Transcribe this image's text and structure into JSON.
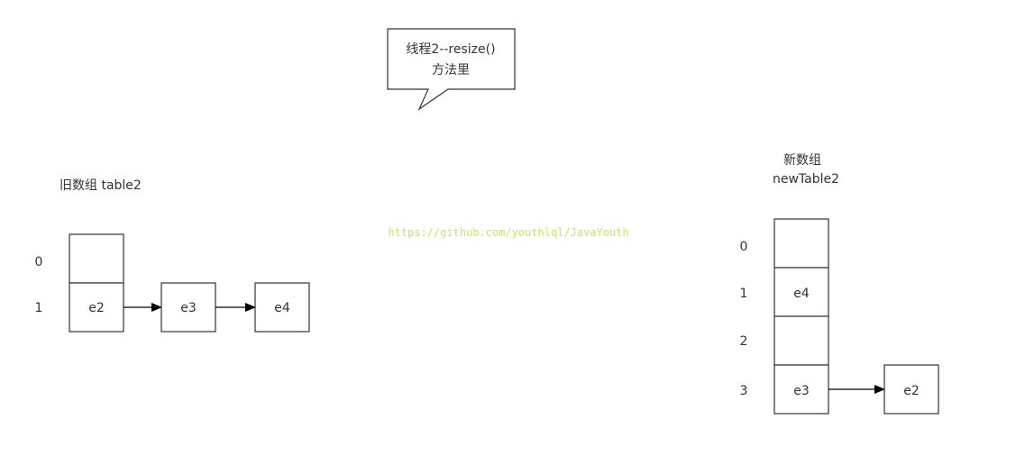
{
  "callout": {
    "line1": "线程2--resize()",
    "line2": "方法里"
  },
  "watermark": "https://github.com/youthlql/JavaYouth",
  "old_array": {
    "title": "旧数组 table2",
    "slots": [
      {
        "index": "0",
        "entry": ""
      },
      {
        "index": "1",
        "entry": "e2"
      }
    ],
    "chain_slot_1": [
      "e3",
      "e4"
    ]
  },
  "new_array": {
    "title_line1": "新数组",
    "title_line2": "newTable2",
    "slots": [
      {
        "index": "0",
        "entry": ""
      },
      {
        "index": "1",
        "entry": "e4"
      },
      {
        "index": "2",
        "entry": ""
      },
      {
        "index": "3",
        "entry": "e3"
      }
    ],
    "chain_slot_3": [
      "e2"
    ]
  }
}
